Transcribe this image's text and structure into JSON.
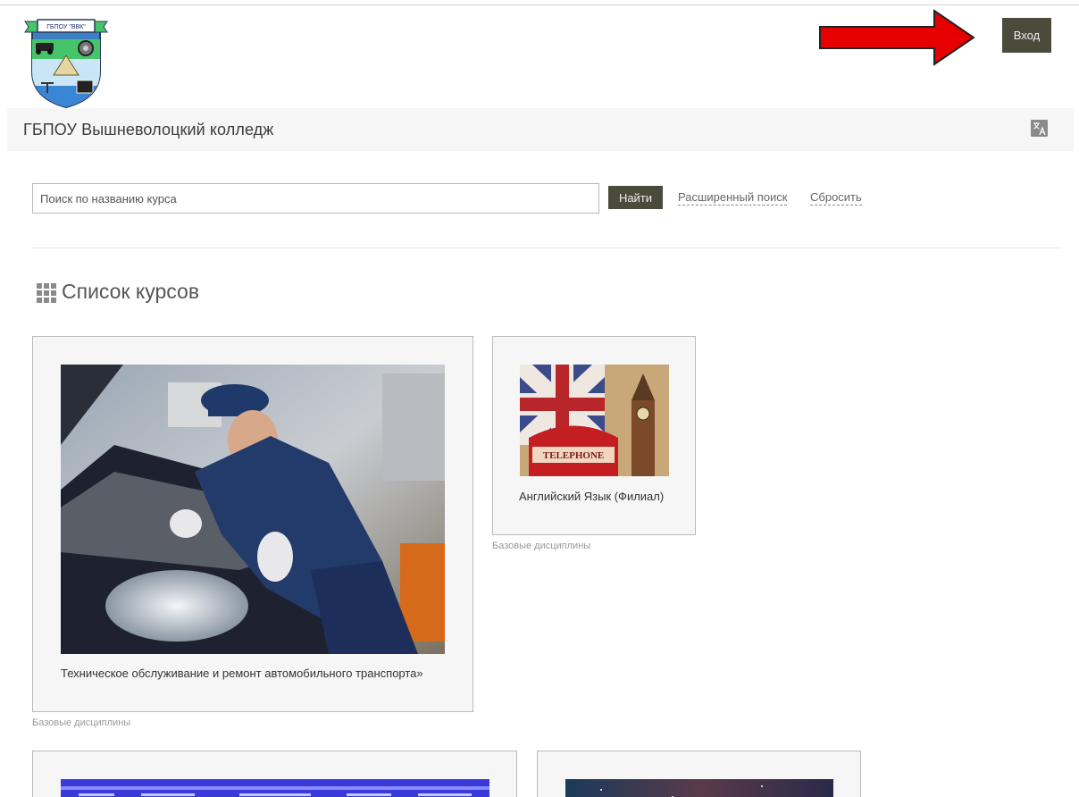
{
  "header": {
    "logo_text": "ГБПОУ \"ВВК\"",
    "login_label": "Вход",
    "site_title": "ГБПОУ Вышневолоцкий колледж",
    "language_icon": "translate-icon"
  },
  "search": {
    "placeholder": "Поиск по названию курса",
    "value": "",
    "find_label": "Найти",
    "advanced_label": "Расширенный поиск",
    "reset_label": "Сбросить"
  },
  "course_list": {
    "heading": "Список курсов",
    "heading_icon": "grid-icon",
    "courses": [
      {
        "title": "Техническое обслуживание и ремонт автомобильного транспорта»",
        "category": "Базовые дисциплины",
        "image": "mechanic-photo"
      },
      {
        "title": "Английский Язык (Филиал)",
        "category": "Базовые дисциплины",
        "image": "london-photo"
      },
      {
        "title": "",
        "category": "",
        "image": "tech-banner-photo"
      },
      {
        "title": "",
        "category": "",
        "image": "space-photo"
      }
    ]
  },
  "colors": {
    "button_bg": "#4b4b3c",
    "title_bar_bg": "#f6f6f6",
    "card_bg": "#f6f6f6",
    "arrow": "#e60000"
  }
}
